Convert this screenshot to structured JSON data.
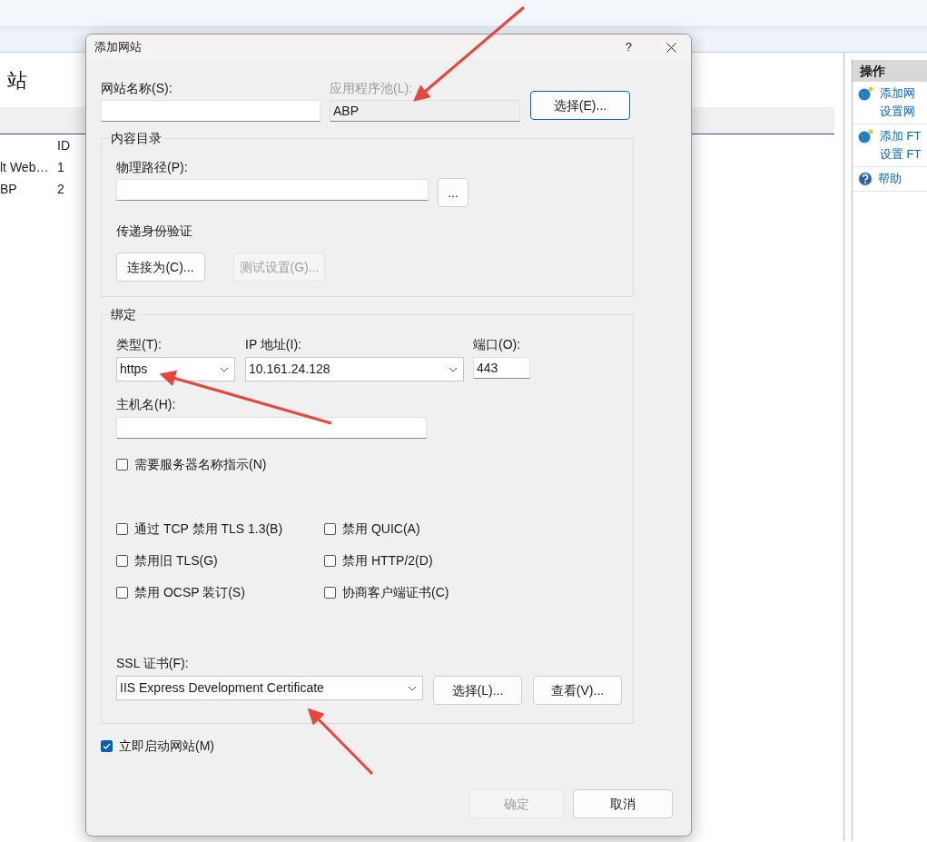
{
  "background": {
    "heading": "站",
    "list": {
      "columns": [
        "ID"
      ],
      "rows": [
        {
          "name": "lt Web…",
          "id": "1"
        },
        {
          "name": "BP",
          "id": "2"
        }
      ]
    },
    "actions_panel": {
      "title": "操作",
      "items": [
        {
          "kind": "globe",
          "lines": [
            "添加网",
            "设置网"
          ]
        },
        {
          "kind": "globe",
          "lines": [
            "添加 FT",
            "设置 FT"
          ]
        },
        {
          "kind": "help",
          "lines": [
            "帮助"
          ]
        }
      ]
    }
  },
  "dialog": {
    "title": "添加网站",
    "help": "?",
    "site_name": {
      "label": "网站名称(S):"
    },
    "app_pool": {
      "label": "应用程序池(L):",
      "value": "ABP",
      "disabled": true,
      "button": "选择(E)..."
    },
    "content_directory": {
      "title": "内容目录",
      "path_label": "物理路径(P):",
      "browse_button": "...",
      "auth_label": "传递身份验证",
      "connect_button": {
        "label": "连接为(C)...",
        "disabled": false
      },
      "test_button": {
        "label": "测试设置(G)...",
        "disabled": true
      }
    },
    "binding": {
      "title": "绑定",
      "type": {
        "label": "类型(T):",
        "value": "https"
      },
      "ip": {
        "label": "IP 地址(I):",
        "value": "10.161.24.128"
      },
      "port": {
        "label": "端口(O):",
        "value": "443"
      },
      "host": {
        "label": "主机名(H):"
      },
      "sni": {
        "label": "需要服务器名称指示(N)",
        "checked": false
      },
      "options": [
        {
          "label": "通过 TCP 禁用 TLS 1.3(B)",
          "checked": false
        },
        {
          "label": "禁用 QUIC(A)",
          "checked": false
        },
        {
          "label": "禁用旧 TLS(G)",
          "checked": false
        },
        {
          "label": "禁用 HTTP/2(D)",
          "checked": false
        },
        {
          "label": "禁用 OCSP 装订(S)",
          "checked": false
        },
        {
          "label": "协商客户端证书(C)",
          "checked": false
        }
      ],
      "ssl": {
        "label": "SSL 证书(F):",
        "value": "IIS Express Development Certificate",
        "select_button": "选择(L)...",
        "view_button": "查看(V)..."
      }
    },
    "start_now": {
      "label": "立即启动网站(M)",
      "checked": true
    },
    "ok": {
      "label": "确定",
      "disabled": true
    },
    "cancel": {
      "label": "取消",
      "disabled": false
    }
  }
}
